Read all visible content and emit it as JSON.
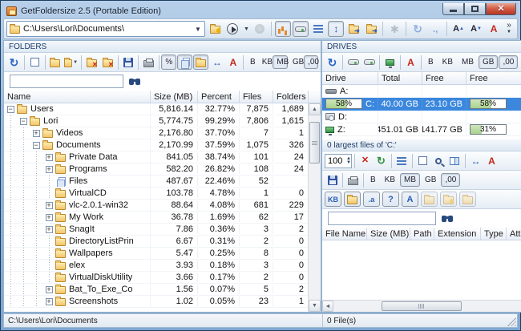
{
  "window": {
    "title": "GetFoldersize 2.5 (Portable Edition)"
  },
  "toolbar": {
    "path_value": "C:\\Users\\Lori\\Documents\\",
    "overflow_label": "»"
  },
  "units": {
    "b": "B",
    "kb": "KB",
    "mb": "MB",
    "gb": "GB",
    "dec": ",00"
  },
  "labels": {
    "percent_button": "%",
    "font_color_button": "A",
    "font_bigger": "A",
    "font_smaller": "A",
    "filter_kb": "KB",
    "filter_a": ".a",
    "filter_q": "?",
    "filter_A": "A"
  },
  "folders_panel": {
    "title": "FOLDERS",
    "search_value": "",
    "columns": [
      "Name",
      "Size (MB)",
      "Percent",
      "Files",
      "Folders"
    ],
    "rows": [
      {
        "name": "Users",
        "level": 1,
        "toggle": "minus",
        "icon": "folder",
        "size": "5,816.14",
        "percent": "32.77%",
        "files": "7,875",
        "folders": "1,689"
      },
      {
        "name": "Lori",
        "level": 2,
        "toggle": "minus",
        "icon": "folder",
        "size": "5,774.75",
        "percent": "99.29%",
        "files": "7,806",
        "folders": "1,615"
      },
      {
        "name": "Videos",
        "level": 3,
        "toggle": "plus",
        "icon": "folder",
        "size": "2,176.80",
        "percent": "37.70%",
        "files": "7",
        "folders": "1"
      },
      {
        "name": "Documents",
        "level": 3,
        "toggle": "minus",
        "icon": "folder",
        "size": "2,170.99",
        "percent": "37.59%",
        "files": "1,075",
        "folders": "326"
      },
      {
        "name": "Private Data",
        "level": 4,
        "toggle": "plus",
        "icon": "folder",
        "size": "841.05",
        "percent": "38.74%",
        "files": "101",
        "folders": "24"
      },
      {
        "name": "Programs",
        "level": 4,
        "toggle": "plus",
        "icon": "folder",
        "size": "582.20",
        "percent": "26.82%",
        "files": "108",
        "folders": "24"
      },
      {
        "name": "Files",
        "level": 4,
        "toggle": "none",
        "icon": "files",
        "size": "487.67",
        "percent": "22.46%",
        "files": "52",
        "folders": ""
      },
      {
        "name": "VirtualCD",
        "level": 4,
        "toggle": "none",
        "icon": "folder",
        "size": "103.78",
        "percent": "4.78%",
        "files": "1",
        "folders": "0"
      },
      {
        "name": "vlc-2.0.1-win32",
        "level": 4,
        "toggle": "plus",
        "icon": "folder",
        "size": "88.64",
        "percent": "4.08%",
        "files": "681",
        "folders": "229"
      },
      {
        "name": "My Work",
        "level": 4,
        "toggle": "plus",
        "icon": "folder",
        "size": "36.78",
        "percent": "1.69%",
        "files": "62",
        "folders": "17"
      },
      {
        "name": "SnagIt",
        "level": 4,
        "toggle": "plus",
        "icon": "folder",
        "size": "7.86",
        "percent": "0.36%",
        "files": "3",
        "folders": "2"
      },
      {
        "name": "DirectoryListPrin",
        "level": 4,
        "toggle": "none",
        "icon": "folder",
        "size": "6.67",
        "percent": "0.31%",
        "files": "2",
        "folders": "0"
      },
      {
        "name": "Wallpapers",
        "level": 4,
        "toggle": "none",
        "icon": "folder",
        "size": "5.47",
        "percent": "0.25%",
        "files": "8",
        "folders": "0"
      },
      {
        "name": "elex",
        "level": 4,
        "toggle": "none",
        "icon": "folder",
        "size": "3.93",
        "percent": "0.18%",
        "files": "3",
        "folders": "0"
      },
      {
        "name": "VirtualDiskUtility",
        "level": 4,
        "toggle": "none",
        "icon": "folder",
        "size": "3.66",
        "percent": "0.17%",
        "files": "2",
        "folders": "0"
      },
      {
        "name": "Bat_To_Exe_Co",
        "level": 4,
        "toggle": "plus",
        "icon": "folder",
        "size": "1.56",
        "percent": "0.07%",
        "files": "5",
        "folders": "2"
      },
      {
        "name": "Screenshots",
        "level": 4,
        "toggle": "plus",
        "icon": "folder",
        "size": "1.02",
        "percent": "0.05%",
        "files": "23",
        "folders": "1"
      }
    ]
  },
  "drives_panel": {
    "title": "DRIVES",
    "columns": [
      "Drive",
      "Total",
      "Free",
      "Free"
    ],
    "rows": [
      {
        "letter": "A:",
        "icon": "floppy-drive",
        "total": "",
        "free": "",
        "bar": "",
        "selected": false
      },
      {
        "letter": "C:",
        "icon": "none",
        "total": "40.00 GB",
        "free": "23.10 GB",
        "bar": "58%",
        "bar_value": 58,
        "drive_bar": "58%",
        "drive_bar_value": 58,
        "selected": true
      },
      {
        "letter": "D:",
        "icon": "cd-drive",
        "total": "",
        "free": "",
        "bar": "",
        "selected": false
      },
      {
        "letter": "Z:",
        "icon": "network-drive",
        "total": "451.01 GB",
        "free": "141.77 GB",
        "bar": "31%",
        "bar_value": 31,
        "selected": false
      }
    ]
  },
  "files_panel": {
    "title": "0 largest files of 'C:'",
    "count_value": "100",
    "search_value": "",
    "columns": [
      "File Name",
      "Size (MB)",
      "Path",
      "Extension",
      "Type",
      "Attrib"
    ]
  },
  "statusbar": {
    "left": "C:\\Users\\Lori\\Documents",
    "right": "0 File(s)"
  },
  "colors": {
    "selection": "#3a87dd",
    "bar_fill": "#a9d18e",
    "title_accent": "#7ea6d0"
  }
}
